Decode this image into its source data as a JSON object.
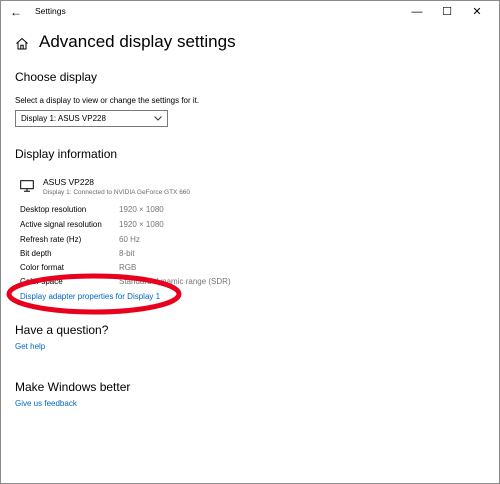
{
  "window": {
    "app_title": "Settings",
    "back_glyph": "←",
    "min_glyph": "—",
    "max_glyph": "☐",
    "close_glyph": "✕"
  },
  "page": {
    "title": "Advanced display settings"
  },
  "choose_display": {
    "heading": "Choose display",
    "description": "Select a display to view or change the settings for it.",
    "selected_display": "Display 1: ASUS VP228"
  },
  "display_information": {
    "heading": "Display information",
    "monitor_name": "ASUS VP228",
    "monitor_connection": "Display 1: Connected to NVIDIA GeForce GTX 660",
    "rows": [
      {
        "label": "Desktop resolution",
        "value": "1920 × 1080"
      },
      {
        "label": "Active signal resolution",
        "value": "1920 × 1080"
      },
      {
        "label": "Refresh rate (Hz)",
        "value": "60 Hz"
      },
      {
        "label": "Bit depth",
        "value": "8-bit"
      },
      {
        "label": "Color format",
        "value": "RGB"
      },
      {
        "label": "Color space",
        "value": "Standard dynamic range (SDR)"
      }
    ],
    "adapter_link": "Display adapter properties for Display 1"
  },
  "question": {
    "heading": "Have a question?",
    "link": "Get help"
  },
  "feedback": {
    "heading": "Make Windows better",
    "link": "Give us feedback"
  },
  "colors": {
    "link": "#0067c0",
    "annotation": "#e8001c"
  },
  "icons": {
    "home": "home-icon",
    "monitor": "monitor-icon",
    "back": "back-arrow-icon",
    "chevron": "chevron-down-icon"
  }
}
